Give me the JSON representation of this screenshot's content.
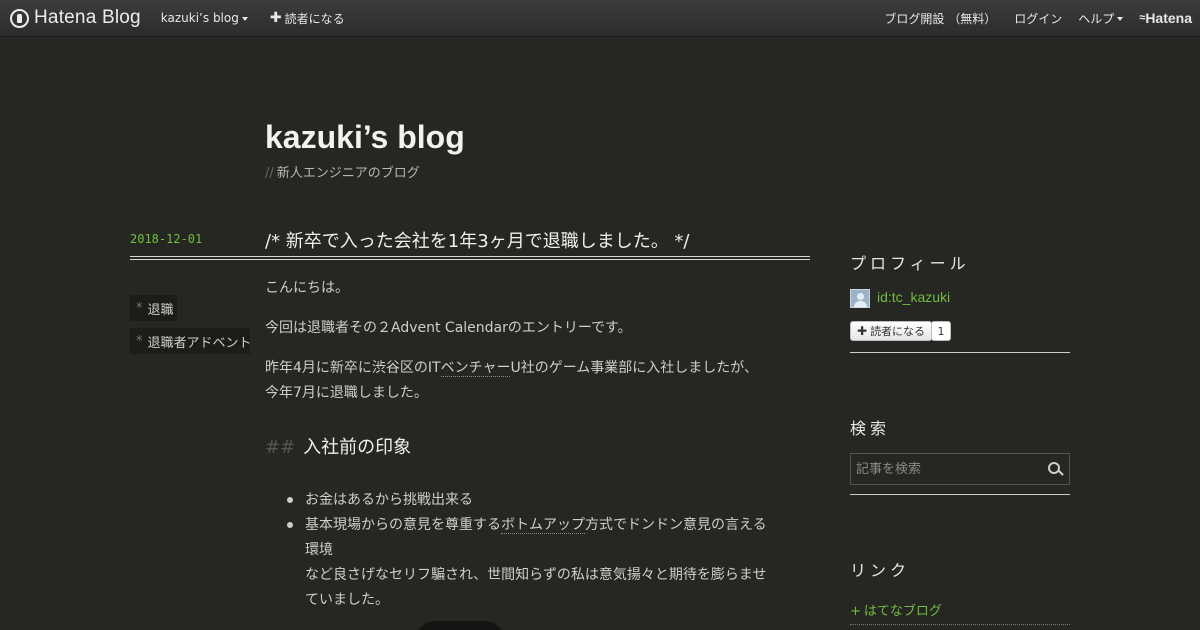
{
  "topbar": {
    "brand": "Hatena Blog",
    "blog_menu": "kazuki’s blog",
    "subscribe": "読者になる",
    "open_blog": "ブログ開設 （無料）",
    "login": "ログイン",
    "help": "ヘルプ",
    "hatena": "Hatena"
  },
  "blog": {
    "title": "kazuki’s blog",
    "description_prefix": "//",
    "description": "新人エンジニアのブログ"
  },
  "entry": {
    "date": "2018-12-01",
    "title": "/*  新卒で入った会社を1年3ヶ月で退職しました。   */",
    "categories": [
      "退職",
      "退職者アドベント"
    ],
    "paragraphs": {
      "p1": "こんにちは。",
      "p2": "今回は退職者その２Advent Calendarのエントリーです。",
      "p3_a": "昨年4月に新卒に渋谷区のIT",
      "p3_kw": "ベンチャー",
      "p3_b": "U社のゲーム事業部に入社しましたが、",
      "p3_c": "今年7月に退職しました。"
    },
    "heading_prefix": "##",
    "heading": "入社前の印象",
    "list": {
      "item1": "お金はあるから挑戦出来る",
      "item2_a": "基本現場からの意見を尊重する",
      "item2_kw": "ボトムアップ",
      "item2_b": "方式でドンドン意見の言える",
      "item2_c": "環境",
      "cont1": "など良さげなセリフ騙され、世間知らずの私は意気揚々と期待を膨らませ",
      "cont2": "ていました。"
    }
  },
  "sidebar": {
    "profile_heading": "プロフィール",
    "profile_id": "id:tc_kazuki",
    "subscribe": "読者になる",
    "subscriber_count": "1",
    "search_heading": "検索",
    "search_placeholder": "記事を検索",
    "links_heading": "リンク",
    "link_plus": "+",
    "link_hatena": "はてなブログ"
  },
  "icons": [
    "hatena-logo-icon",
    "caret-down-icon",
    "plus-icon",
    "search-icon",
    "avatar-icon"
  ],
  "colors": {
    "background": "#262622",
    "accent_green": "#6fbe3f",
    "text": "#cfcfc8"
  }
}
